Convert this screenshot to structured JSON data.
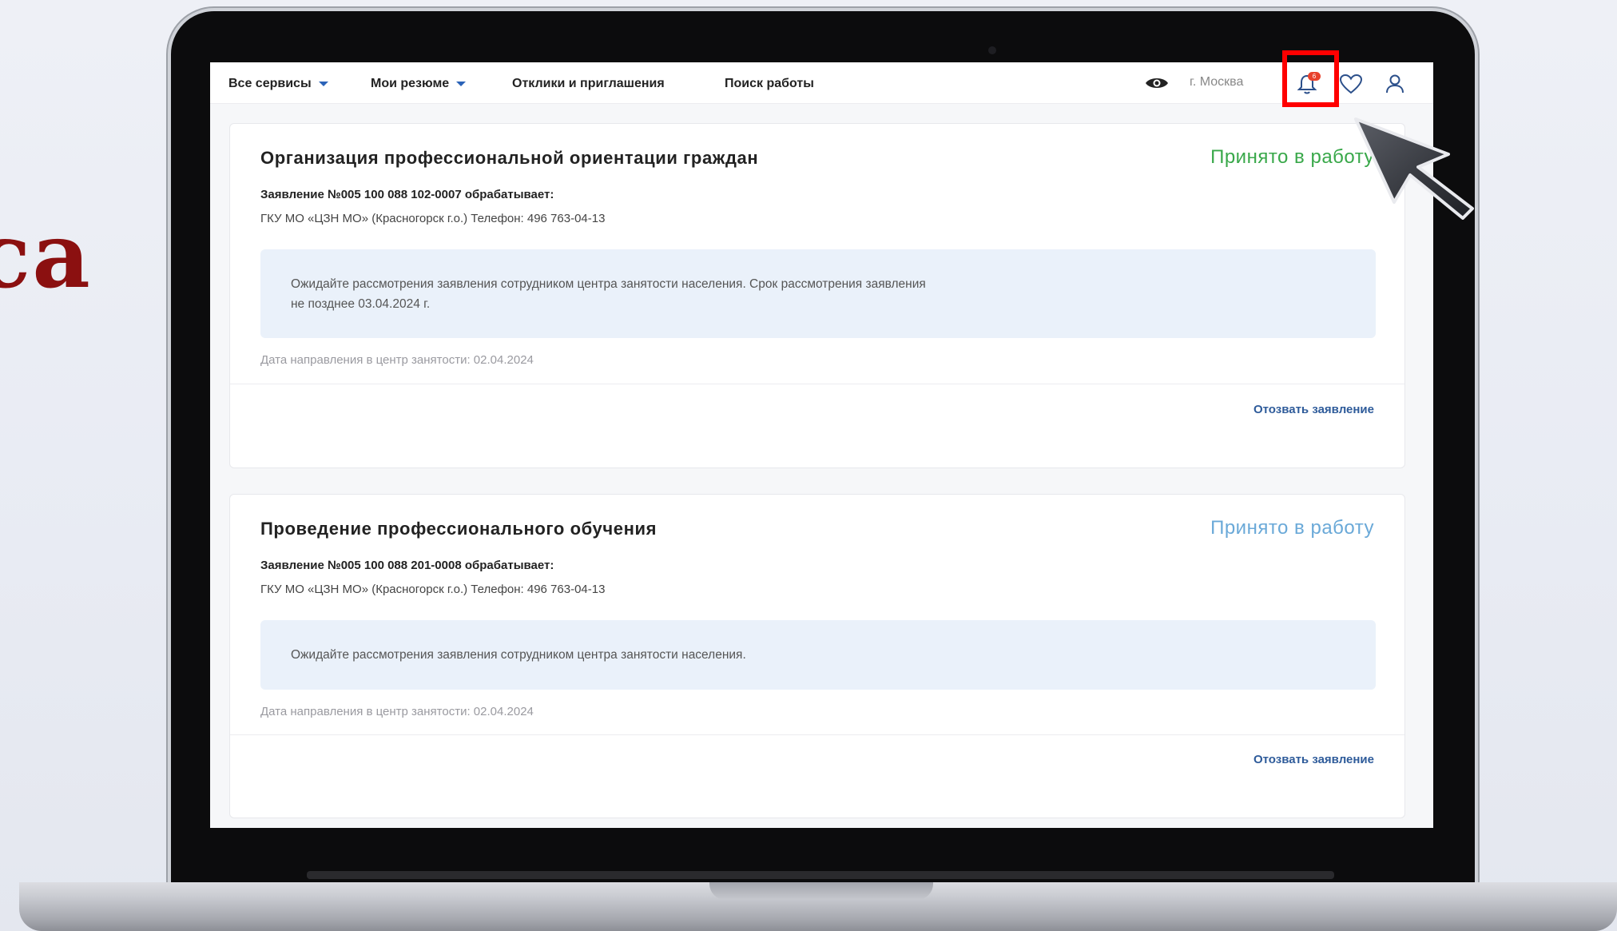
{
  "slide": {
    "partial_word": "ca"
  },
  "nav": {
    "items": [
      {
        "label": "Все сервисы",
        "dropdown": true
      },
      {
        "label": "Мои резюме",
        "dropdown": true
      },
      {
        "label": "Отклики и приглашения",
        "dropdown": false
      },
      {
        "label": "Поиск работы",
        "dropdown": false
      }
    ],
    "city": "г. Москва",
    "notifications_count": "6"
  },
  "cards": [
    {
      "title": "Организация профессиональной ориентации граждан",
      "status": "Принято в работу",
      "status_color": "#39a84a",
      "application": "Заявление №005 100 088 102-0007 обрабатывает:",
      "organization": "ГКУ МО «ЦЗН МО» (Красногорск г.о.) Телефон: 496 763-04-13",
      "notice_line1": "Ожидайте рассмотрения заявления сотрудником центра занятости населения. Срок рассмотрения заявления",
      "notice_line2": "не позднее 03.04.2024 г.",
      "date": "Дата направления в центр занятости: 02.04.2024",
      "action": "Отозвать заявление"
    },
    {
      "title": "Проведение профессионального обучения",
      "status": "Принято в работу",
      "status_color": "#6aa9d8",
      "application": "Заявление №005 100 088 201-0008 обрабатывает:",
      "organization": "ГКУ МО «ЦЗН МО» (Красногорск г.о.) Телефон: 496 763-04-13",
      "notice_line1": "Ожидайте рассмотрения заявления сотрудником центра занятости населения.",
      "date": "Дата направления в центр занятости: 02.04.2024",
      "action": "Отозвать заявление"
    }
  ],
  "colors": {
    "accent": "#2b63b8",
    "highlight": "#ff0000",
    "title_word": "#8b1010"
  }
}
